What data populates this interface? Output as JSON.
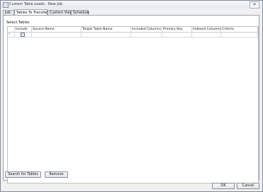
{
  "window": {
    "title": "Custom Table Loads - New Job",
    "close_glyph": "✕"
  },
  "tabs": [
    {
      "label": "Job"
    },
    {
      "label": "Tables To Transfer",
      "active": true
    },
    {
      "label": "Custom Views"
    },
    {
      "label": "Schedule"
    }
  ],
  "panel": {
    "section_label": "Select Tables"
  },
  "grid": {
    "columns": [
      "Include",
      "Source Name",
      "Target Table Name",
      "Included Columns",
      "Primary Key",
      "Indexed Columns",
      "Criteria"
    ],
    "rows": [
      {
        "indicator": "*",
        "include": false,
        "source_name": "",
        "target_table_name": "",
        "included_columns": "",
        "primary_key": "",
        "indexed_columns": "",
        "criteria": ""
      }
    ]
  },
  "buttons": {
    "search_for_tables": "Search for Tables",
    "remove": "Remove",
    "ok": "OK",
    "cancel": "Cancel"
  },
  "icons": {
    "app": "app-icon",
    "close": "close-icon"
  }
}
